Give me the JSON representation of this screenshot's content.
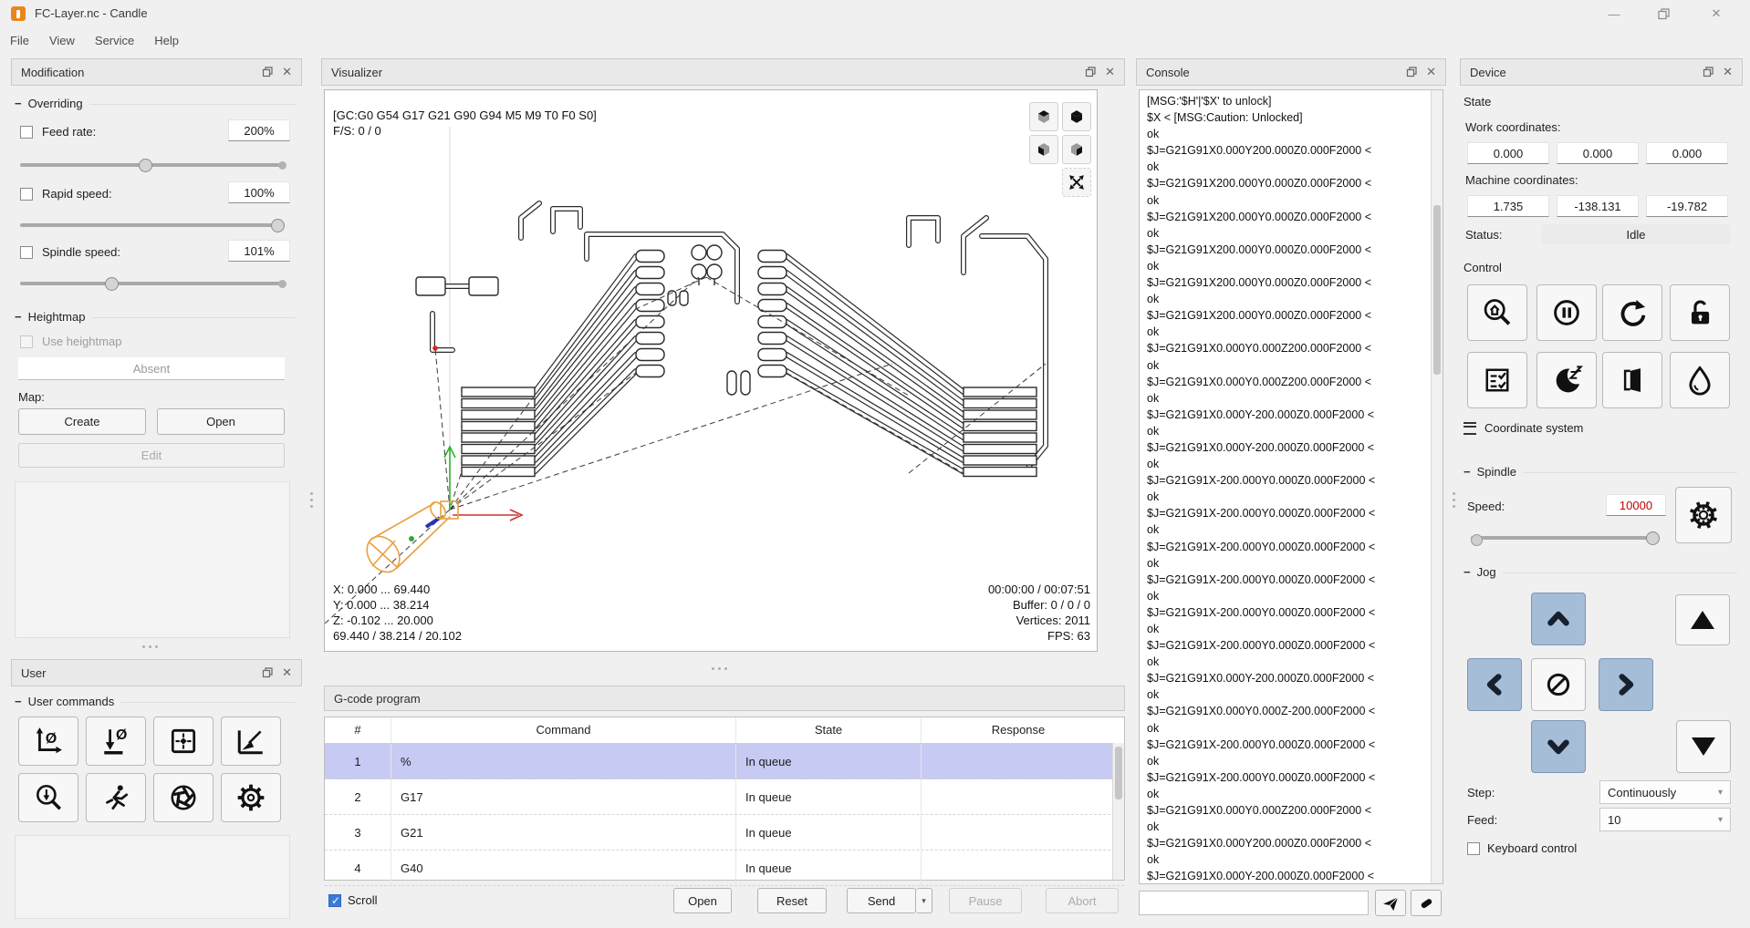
{
  "window": {
    "title": "FC-Layer.nc - Candle"
  },
  "menu": {
    "items": [
      "File",
      "View",
      "Service",
      "Help"
    ]
  },
  "modification": {
    "title": "Modification",
    "overriding_label": "Overriding",
    "feed_label": "Feed rate:",
    "feed_value": "200%",
    "rapid_label": "Rapid speed:",
    "rapid_value": "100%",
    "spindle_label": "Spindle speed:",
    "spindle_value": "101%",
    "heightmap_label": "Heightmap",
    "use_heightmap_label": "Use heightmap",
    "heightmap_status": "Absent",
    "map_label": "Map:",
    "create_label": "Create",
    "open_label": "Open",
    "edit_label": "Edit"
  },
  "user_panel": {
    "title": "User",
    "commands_label": "User commands"
  },
  "visualizer": {
    "title": "Visualizer",
    "gcode_state": "[GC:G0 G54 G17 G21 G90 G94 M5 M9 T0 F0 S0]",
    "feed_spindle": "F/S: 0 / 0",
    "stats_left": [
      "X: 0.000 ... 69.440",
      "Y: 0.000 ... 38.214",
      "Z: -0.102 ... 20.000",
      "69.440 / 38.214 / 20.102"
    ],
    "stats_right": [
      "00:00:00 / 00:07:51",
      "Buffer: 0 / 0 / 0",
      "Vertices: 2011",
      "FPS: 63"
    ]
  },
  "gcode_program": {
    "title": "G-code program",
    "columns": [
      "#",
      "Command",
      "State",
      "Response"
    ],
    "rows": [
      {
        "n": "1",
        "command": "%",
        "state": "In queue",
        "response": ""
      },
      {
        "n": "2",
        "command": "G17",
        "state": "In queue",
        "response": ""
      },
      {
        "n": "3",
        "command": "G21",
        "state": "In queue",
        "response": ""
      },
      {
        "n": "4",
        "command": "G40",
        "state": "In queue",
        "response": ""
      }
    ],
    "scroll_label": "Scroll",
    "open_label": "Open",
    "reset_label": "Reset",
    "send_label": "Send",
    "pause_label": "Pause",
    "abort_label": "Abort"
  },
  "console": {
    "title": "Console",
    "lines": [
      "[MSG:'$H'|'$X' to unlock]",
      "$X < [MSG:Caution: Unlocked]",
      "ok",
      "$J=G21G91X0.000Y200.000Z0.000F2000 <",
      "ok",
      "$J=G21G91X200.000Y0.000Z0.000F2000 <",
      "ok",
      "$J=G21G91X200.000Y0.000Z0.000F2000 <",
      "ok",
      "$J=G21G91X200.000Y0.000Z0.000F2000 <",
      "ok",
      "$J=G21G91X200.000Y0.000Z0.000F2000 <",
      "ok",
      "$J=G21G91X200.000Y0.000Z0.000F2000 <",
      "ok",
      "$J=G21G91X0.000Y0.000Z200.000F2000 <",
      "ok",
      "$J=G21G91X0.000Y0.000Z200.000F2000 <",
      "ok",
      "$J=G21G91X0.000Y-200.000Z0.000F2000 <",
      "ok",
      "$J=G21G91X0.000Y-200.000Z0.000F2000 <",
      "ok",
      "$J=G21G91X-200.000Y0.000Z0.000F2000 <",
      "ok",
      "$J=G21G91X-200.000Y0.000Z0.000F2000 <",
      "ok",
      "$J=G21G91X-200.000Y0.000Z0.000F2000 <",
      "ok",
      "$J=G21G91X-200.000Y0.000Z0.000F2000 <",
      "ok",
      "$J=G21G91X-200.000Y0.000Z0.000F2000 <",
      "ok",
      "$J=G21G91X-200.000Y0.000Z0.000F2000 <",
      "ok",
      "$J=G21G91X0.000Y-200.000Z0.000F2000 <",
      "ok",
      "$J=G21G91X0.000Y0.000Z-200.000F2000 <",
      "ok",
      "$J=G21G91X-200.000Y0.000Z0.000F2000 <",
      "ok",
      "$J=G21G91X-200.000Y0.000Z0.000F2000 <",
      "ok",
      "$J=G21G91X0.000Y0.000Z200.000F2000 <",
      "ok",
      "$J=G21G91X0.000Y200.000Z0.000F2000 <",
      "ok",
      "$J=G21G91X0.000Y-200.000Z0.000F2000 <"
    ]
  },
  "device": {
    "title": "Device",
    "state_label": "State",
    "work_label": "Work coordinates:",
    "work": [
      "0.000",
      "0.000",
      "0.000"
    ],
    "machine_label": "Machine coordinates:",
    "machine": [
      "1.735",
      "-138.131",
      "-19.782"
    ],
    "status_label": "Status:",
    "status": "Idle",
    "control_label": "Control",
    "coordinate_system_label": "Coordinate system",
    "spindle_label": "Spindle",
    "speed_label": "Speed:",
    "speed_value": "10000",
    "jog_label": "Jog",
    "step_label": "Step:",
    "step_value": "Continuously",
    "feed_label": "Feed:",
    "feed_value": "10",
    "keyboard_label": "Keyboard control"
  },
  "colors": {
    "selection": "#c7caf2",
    "jog_button": "#a6bdd7",
    "speed_value_red": "#c00000",
    "checkbox_blue": "#3d7bd9"
  }
}
